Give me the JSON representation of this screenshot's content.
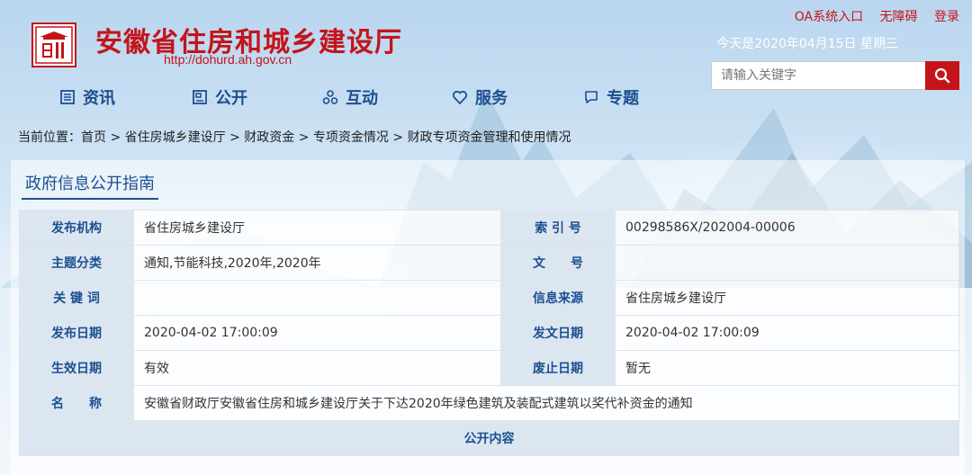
{
  "header": {
    "site_title": "安徽省住房和城乡建设厅",
    "site_url": "http://dohurd.ah.gov.cn",
    "top_links": [
      "OA系统入口",
      "无障碍",
      "登录"
    ],
    "date": "今天是2020年04月15日 星期三",
    "search": {
      "placeholder": "请输入关键字"
    },
    "brand_color": "#c4141a"
  },
  "nav": {
    "items": [
      {
        "label": "资讯",
        "icon": "news-icon"
      },
      {
        "label": "公开",
        "icon": "public-icon"
      },
      {
        "label": "互动",
        "icon": "interact-icon"
      },
      {
        "label": "服务",
        "icon": "heart-icon"
      },
      {
        "label": "专题",
        "icon": "chat-icon"
      }
    ],
    "color": "#1c4f8f"
  },
  "breadcrumb": {
    "prefix": "当前位置：",
    "items": [
      "首页",
      "省住房城乡建设厅",
      "财政资金",
      "专项资金情况",
      "财政专项资金管理和使用情况"
    ],
    "separator": " > "
  },
  "section": {
    "title": "政府信息公开指南"
  },
  "info_table": {
    "rows": [
      {
        "l1": "发布机构",
        "v1": "省住房城乡建设厅",
        "l2": "索 引 号",
        "v2": "00298586X/202004-00006"
      },
      {
        "l1": "主题分类",
        "v1": "通知,节能科技,2020年,2020年",
        "l2": "文　　号",
        "v2": ""
      },
      {
        "l1": "关 键 词",
        "v1": "",
        "l2": "信息来源",
        "v2": "省住房城乡建设厅"
      },
      {
        "l1": "发布日期",
        "v1": "2020-04-02 17:00:09",
        "l2": "发文日期",
        "v2": "2020-04-02 17:00:09"
      },
      {
        "l1": "生效日期",
        "v1": "有效",
        "l2": "废止日期",
        "v2": "暂无"
      }
    ],
    "name_label": "名　　称",
    "name_value": "安徽省财政厅安徽省住房和城乡建设厅关于下达2020年绿色建筑及装配式建筑以奖代补资金的通知",
    "footer": "公开内容"
  }
}
